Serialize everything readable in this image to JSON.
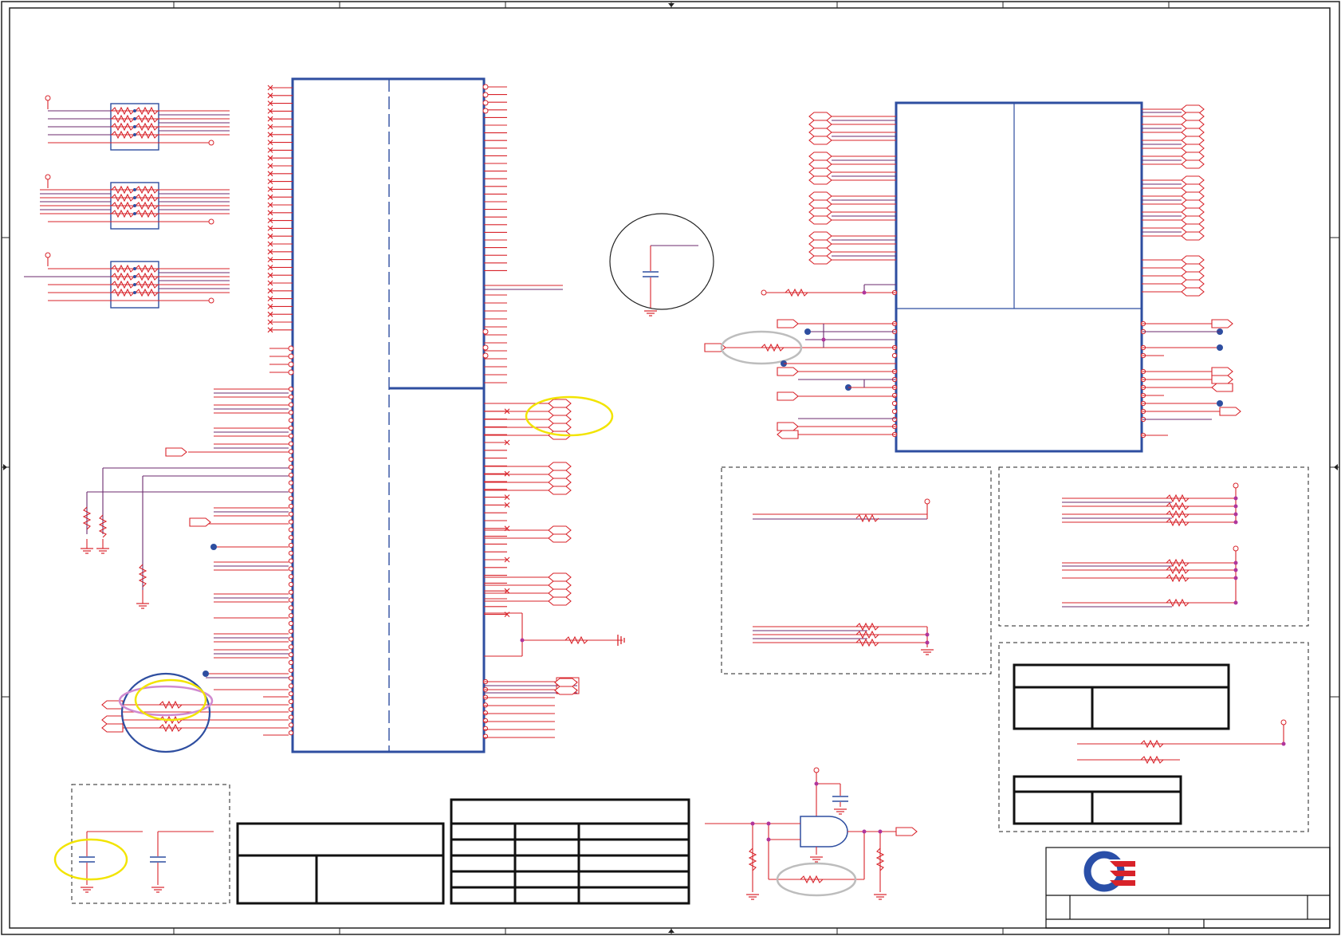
{
  "diagram": {
    "kind": "electronic-schematic-sheet",
    "text_visible": false,
    "colors": {
      "wire": "#d8232a",
      "net": "#6b2a6e",
      "ic_outline": "#2e4ea0",
      "junction": "#2e4ea0",
      "annotation_yellow": "#f2e400",
      "annotation_gray": "#bdbdbd",
      "annotation_pink": "#d08ad0",
      "annotation_blue": "#2e4ea0",
      "logo_blue": "#2a4fa8",
      "logo_red": "#d8232a"
    },
    "icons": {
      "logo": "company-logo-icon",
      "ground": "ground-icon",
      "resistor": "resistor-icon",
      "capacitor": "capacitor-icon",
      "and_gate": "and-gate-icon",
      "port": "port-arrow-icon"
    }
  }
}
